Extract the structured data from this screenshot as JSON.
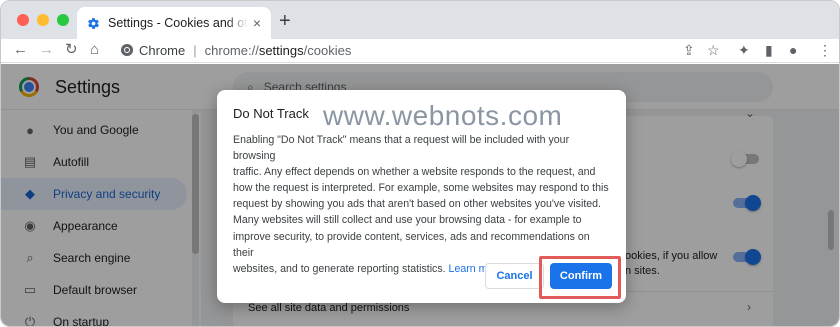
{
  "colors": {
    "accent": "#1a73e8",
    "highlight": "#e15b5b",
    "close": "#fe5f57",
    "minimize": "#febc2e",
    "maximize": "#28c840"
  },
  "tab": {
    "title": "Settings - Cookies and other site data",
    "close_icon": "×",
    "new_tab_icon": "+"
  },
  "toolbar": {
    "back": "←",
    "forward": "→",
    "reload": "↻",
    "home": "⌂",
    "chip_label": "Chrome",
    "url_prefix": "chrome://",
    "url_host": "settings",
    "url_path": "/cookies",
    "share": "⇪",
    "bookmark": "☆",
    "extensions": "✦",
    "sidepanel": "▮",
    "profile": "●",
    "menu": "⋮"
  },
  "settings": {
    "title": "Settings",
    "search_placeholder": "Search settings",
    "nav": [
      {
        "label": "You and Google",
        "icon": "person-icon",
        "glyph": "●"
      },
      {
        "label": "Autofill",
        "icon": "autofill-icon",
        "glyph": "▤"
      },
      {
        "label": "Privacy and security",
        "icon": "shield-icon",
        "glyph": "◆"
      },
      {
        "label": "Appearance",
        "icon": "palette-icon",
        "glyph": "◉"
      },
      {
        "label": "Search engine",
        "icon": "search-icon",
        "glyph": "⌕"
      },
      {
        "label": "Default browser",
        "icon": "browser-icon",
        "glyph": "▭"
      },
      {
        "label": "On startup",
        "icon": "power-icon",
        "glyph": "⏻"
      }
    ],
    "content": {
      "partial_line1": "ookies, if you allow",
      "partial_line2": "n sites.",
      "see_all": "See all site data and permissions"
    }
  },
  "dialog": {
    "title": "Do Not Track",
    "watermark": "www.webnots.com",
    "lines": [
      "Enabling \"Do Not Track\" means that a request will be included with your browsing",
      "traffic. Any effect depends on whether a website responds to the request, and",
      "how the request is interpreted. For example, some websites may respond to this",
      "request by showing you ads that aren't based on other websites you've visited.",
      "Many websites will still collect and use your browsing data - for example to",
      "improve security, to provide content, services, ads and recommendations on their"
    ],
    "last_line": "websites, and to generate reporting statistics.",
    "learn_more": "Learn more",
    "cancel": "Cancel",
    "confirm": "Confirm"
  }
}
